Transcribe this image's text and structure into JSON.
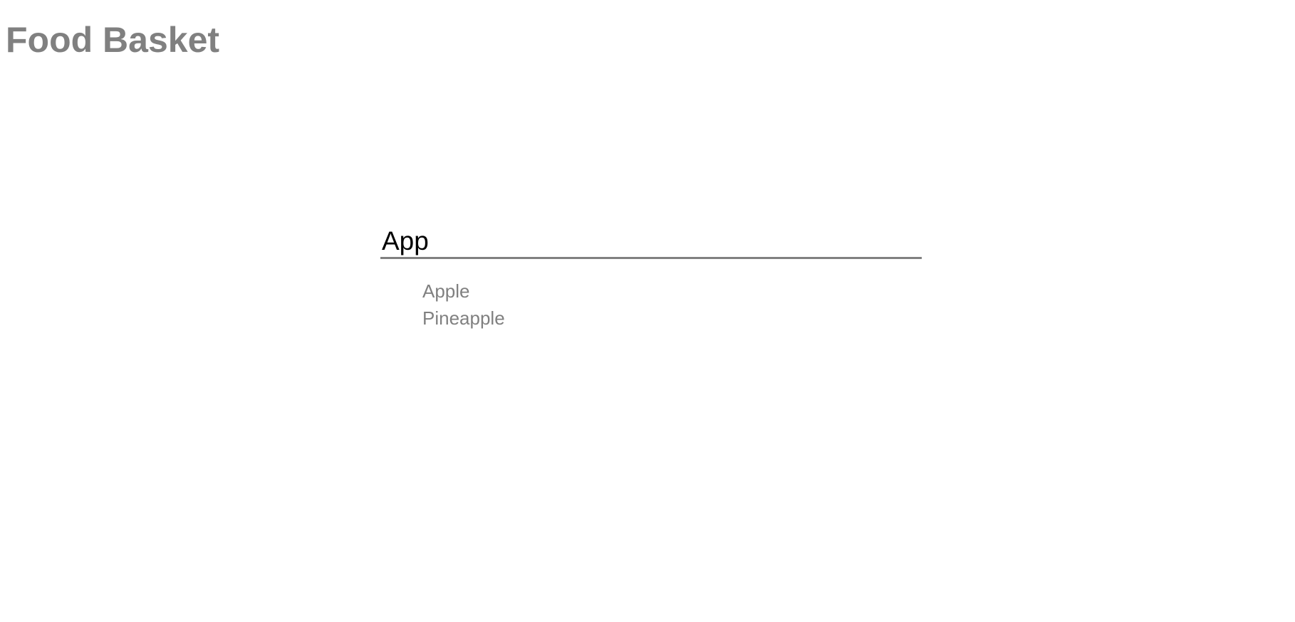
{
  "header": {
    "title": "Food Basket"
  },
  "search": {
    "value": "App",
    "suggestions": [
      {
        "label": "Apple"
      },
      {
        "label": "Pineapple"
      }
    ]
  },
  "colors": {
    "title": "#808080",
    "input_text": "#000000",
    "input_underline": "#808080",
    "suggestion_text": "#808080",
    "background": "#ffffff"
  }
}
